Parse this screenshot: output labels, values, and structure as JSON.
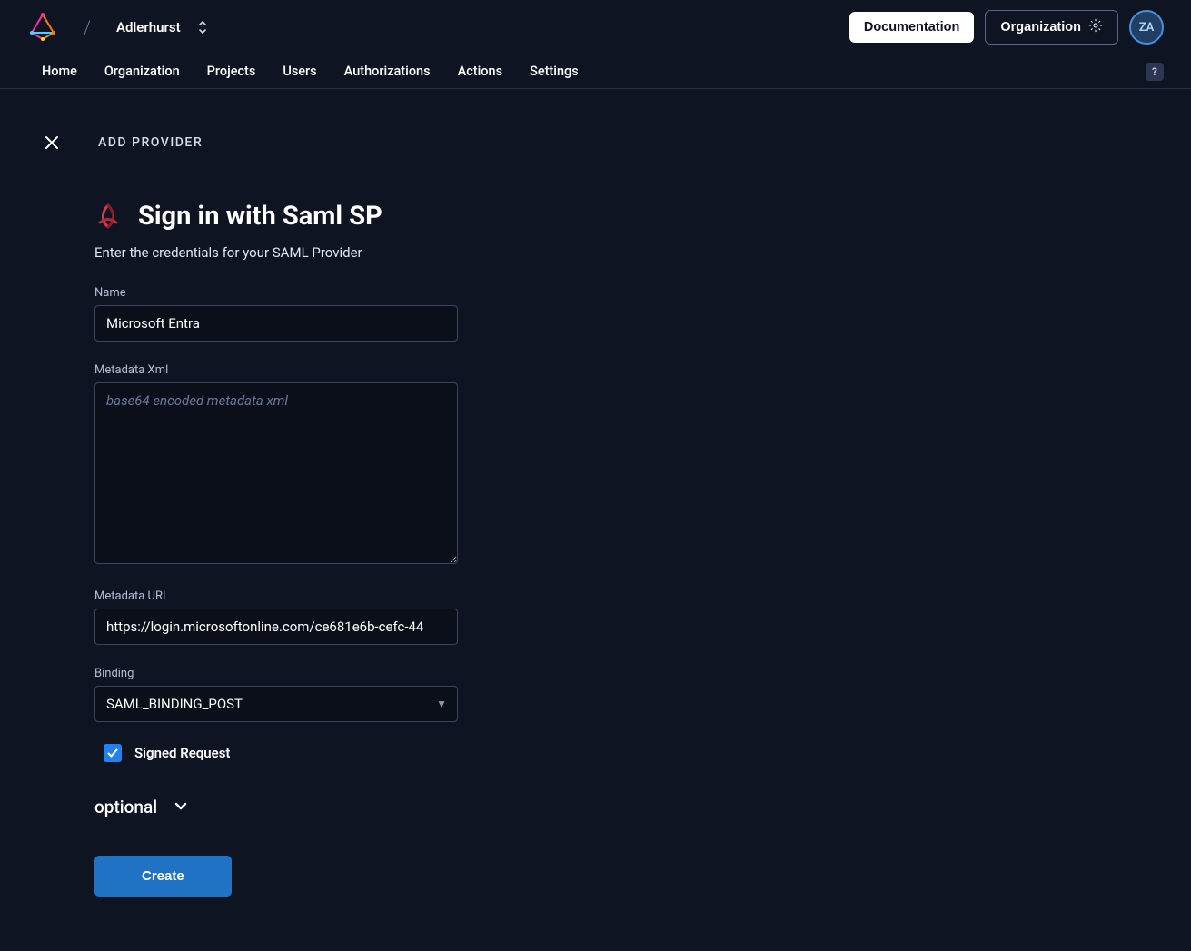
{
  "header": {
    "org_name": "Adlerhurst",
    "documentation_label": "Documentation",
    "organization_label": "Organization",
    "avatar_initials": "ZA"
  },
  "nav": {
    "items": [
      "Home",
      "Organization",
      "Projects",
      "Users",
      "Authorizations",
      "Actions",
      "Settings"
    ],
    "help": "?"
  },
  "page": {
    "breadcrumb": "ADD PROVIDER",
    "title": "Sign in with Saml SP",
    "subtitle": "Enter the credentials for your SAML Provider"
  },
  "form": {
    "name_label": "Name",
    "name_value": "Microsoft Entra",
    "metadata_xml_label": "Metadata Xml",
    "metadata_xml_placeholder": "base64 encoded metadata xml",
    "metadata_xml_value": "",
    "metadata_url_label": "Metadata URL",
    "metadata_url_value": "https://login.microsoftonline.com/ce681e6b-cefc-44",
    "binding_label": "Binding",
    "binding_value": "SAML_BINDING_POST",
    "signed_request_label": "Signed Request",
    "signed_request_checked": true,
    "optional_label": "optional",
    "create_label": "Create"
  }
}
